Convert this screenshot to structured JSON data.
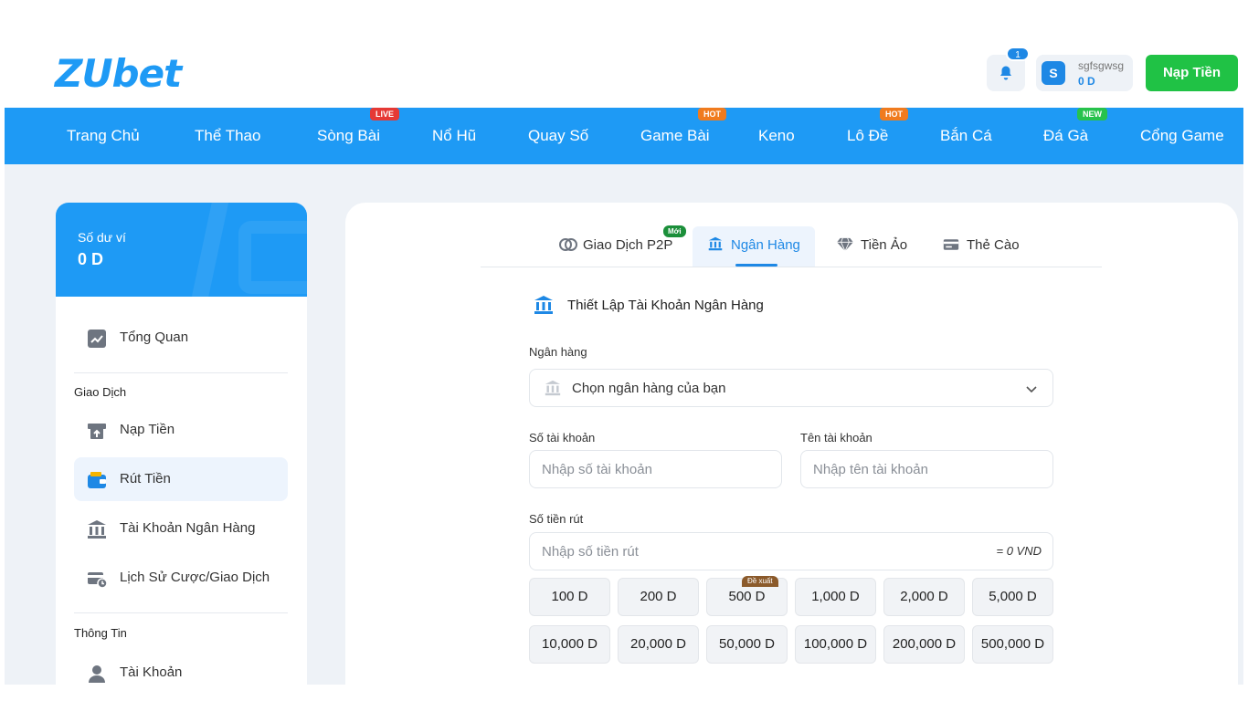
{
  "header": {
    "logo_text": "ZUbet",
    "notification_count": "1",
    "user": {
      "avatar_letter": "S",
      "username": "sgfsgwsg",
      "balance": "0 D"
    },
    "deposit_button": "Nạp Tiền"
  },
  "nav": {
    "items": [
      {
        "label": "Trang Chủ",
        "tag": ""
      },
      {
        "label": "Thể Thao",
        "tag": ""
      },
      {
        "label": "Sòng Bài",
        "tag": "LIVE"
      },
      {
        "label": "Nổ Hũ",
        "tag": ""
      },
      {
        "label": "Quay Số",
        "tag": ""
      },
      {
        "label": "Game Bài",
        "tag": "HOT"
      },
      {
        "label": "Keno",
        "tag": ""
      },
      {
        "label": "Lô Đề",
        "tag": "HOT"
      },
      {
        "label": "Bắn Cá",
        "tag": ""
      },
      {
        "label": "Đá Gà",
        "tag": "NEW"
      },
      {
        "label": "Cổng Game",
        "tag": ""
      }
    ]
  },
  "sidebar": {
    "wallet_label": "Số dư ví",
    "wallet_balance": "0 D",
    "overview": "Tổng Quan",
    "section_transactions": "Giao Dịch",
    "items": [
      {
        "label": "Nạp Tiền",
        "icon": "deposit-icon"
      },
      {
        "label": "Rút Tiền",
        "icon": "wallet-icon"
      },
      {
        "label": "Tài Khoản Ngân Hàng",
        "icon": "bank-icon"
      },
      {
        "label": "Lịch Sử Cược/Giao Dịch",
        "icon": "history-icon"
      }
    ],
    "section_info": "Thông Tin",
    "account": "Tài Khoản"
  },
  "tabs": [
    {
      "label": "Giao Dịch P2P",
      "badge": "Mới"
    },
    {
      "label": "Ngân Hàng",
      "badge": ""
    },
    {
      "label": "Tiền Ảo",
      "badge": ""
    },
    {
      "label": "Thẻ Cào",
      "badge": ""
    }
  ],
  "form": {
    "title": "Thiết Lập Tài Khoản Ngân Hàng",
    "bank_label": "Ngân hàng",
    "bank_select": "Chọn ngân hàng của bạn",
    "account_number_label": "Số tài khoản",
    "account_number_placeholder": "Nhập số tài khoản",
    "account_name_label": "Tên tài khoản",
    "account_name_placeholder": "Nhập tên tài khoản",
    "amount_label": "Số tiền rút",
    "amount_placeholder": "Nhập số tiền rút",
    "amount_approx": "= 0 VND",
    "suggest_tag": "Đề xuất",
    "amounts": [
      "100 D",
      "200 D",
      "500 D",
      "1,000 D",
      "2,000 D",
      "5,000 D",
      "10,000 D",
      "20,000 D",
      "50,000 D",
      "100,000 D",
      "200,000 D",
      "500,000 D"
    ]
  },
  "colors": {
    "brand": "#1e9af5",
    "deposit": "#20c245",
    "active": "#1e88e5"
  }
}
